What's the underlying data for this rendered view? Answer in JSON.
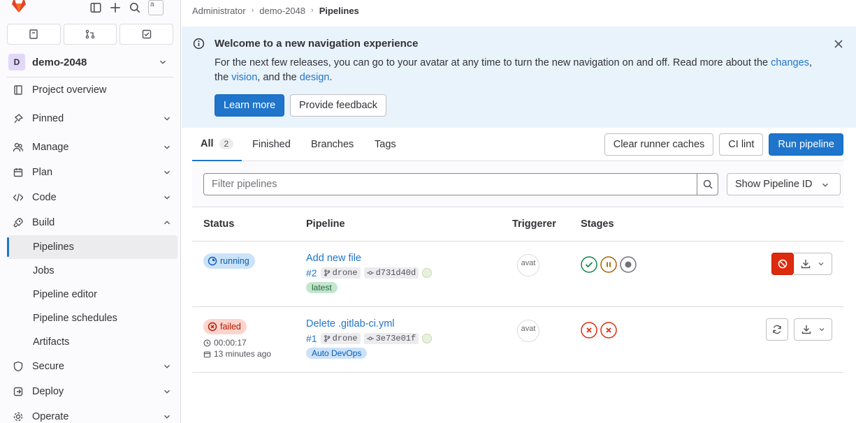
{
  "sidebar": {
    "avatar_alt": "a",
    "project_badge": "D",
    "project_name": "demo-2048",
    "items": [
      {
        "label": "Project overview"
      },
      {
        "label": "Pinned"
      },
      {
        "label": "Manage"
      },
      {
        "label": "Plan"
      },
      {
        "label": "Code"
      },
      {
        "label": "Build"
      }
    ],
    "build_sub": [
      "Pipelines",
      "Jobs",
      "Pipeline editor",
      "Pipeline schedules",
      "Artifacts"
    ],
    "items2": [
      {
        "label": "Secure"
      },
      {
        "label": "Deploy"
      },
      {
        "label": "Operate"
      }
    ]
  },
  "breadcrumb": {
    "a": "Administrator",
    "b": "demo-2048",
    "c": "Pipelines"
  },
  "banner": {
    "title": "Welcome to a new navigation experience",
    "text1": "For the next few releases, you can go to your avatar at any time to turn the new navigation on and off. Read more about the ",
    "link1": "changes",
    "text2": ", the ",
    "link2": "vision",
    "text3": ", and the ",
    "link3": "design",
    "text4": ".",
    "learn_more": "Learn more",
    "feedback": "Provide feedback"
  },
  "tabs": {
    "all": "All",
    "all_count": "2",
    "finished": "Finished",
    "branches": "Branches",
    "tags": "Tags"
  },
  "actions": {
    "clear": "Clear runner caches",
    "lint": "CI lint",
    "run": "Run pipeline"
  },
  "filter": {
    "placeholder": "Filter pipelines",
    "select": "Show Pipeline ID"
  },
  "table": {
    "status": "Status",
    "pipeline": "Pipeline",
    "triggerer": "Triggerer",
    "stages": "Stages"
  },
  "rows": [
    {
      "status": "running",
      "title": "Add new file",
      "id": "#2",
      "ref": "drone",
      "sha": "d731d40d",
      "tag": "latest",
      "trig_alt": "avat"
    },
    {
      "status": "failed",
      "duration": "00:00:17",
      "ago": "13 minutes ago",
      "title": "Delete .gitlab-ci.yml",
      "id": "#1",
      "ref": "drone",
      "sha": "3e73e01f",
      "tag": "Auto DevOps",
      "trig_alt": "avat"
    }
  ],
  "colors": {
    "accent": "#1f75cb",
    "danger": "#dd2b0e",
    "success": "#108548",
    "warning": "#ab6100"
  }
}
